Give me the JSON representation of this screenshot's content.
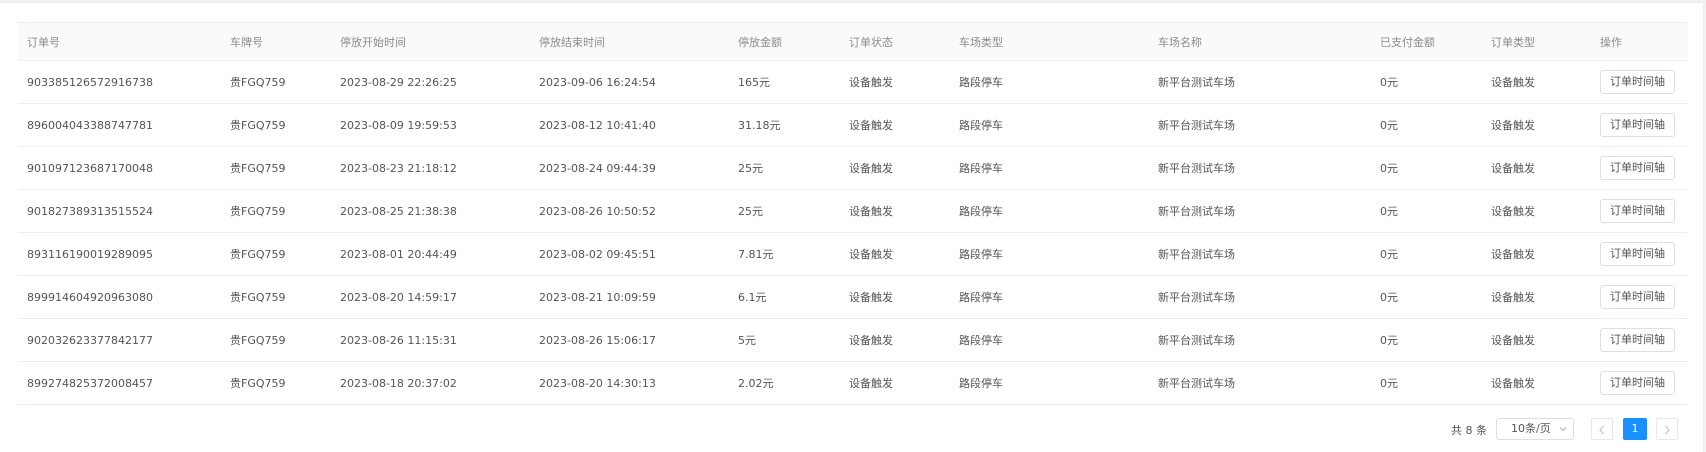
{
  "table": {
    "columns": [
      "订单号",
      "车牌号",
      "停放开始时间",
      "停放结束时间",
      "停放金额",
      "订单状态",
      "车场类型",
      "车场名称",
      "已支付金额",
      "订单类型",
      "操作"
    ],
    "rows": [
      {
        "order_no": "903385126572916738",
        "plate": "贵FGQ759",
        "start": "2023-08-29 22:26:25",
        "end": "2023-09-06 16:24:54",
        "amount": "165元",
        "status": "设备触发",
        "lot_type": "路段停车",
        "lot_name": "新平台测试车场",
        "paid": "0元",
        "order_type": "设备触发"
      },
      {
        "order_no": "896004043388747781",
        "plate": "贵FGQ759",
        "start": "2023-08-09 19:59:53",
        "end": "2023-08-12 10:41:40",
        "amount": "31.18元",
        "status": "设备触发",
        "lot_type": "路段停车",
        "lot_name": "新平台测试车场",
        "paid": "0元",
        "order_type": "设备触发"
      },
      {
        "order_no": "901097123687170048",
        "plate": "贵FGQ759",
        "start": "2023-08-23 21:18:12",
        "end": "2023-08-24 09:44:39",
        "amount": "25元",
        "status": "设备触发",
        "lot_type": "路段停车",
        "lot_name": "新平台测试车场",
        "paid": "0元",
        "order_type": "设备触发"
      },
      {
        "order_no": "901827389313515524",
        "plate": "贵FGQ759",
        "start": "2023-08-25 21:38:38",
        "end": "2023-08-26 10:50:52",
        "amount": "25元",
        "status": "设备触发",
        "lot_type": "路段停车",
        "lot_name": "新平台测试车场",
        "paid": "0元",
        "order_type": "设备触发"
      },
      {
        "order_no": "893116190019289095",
        "plate": "贵FGQ759",
        "start": "2023-08-01 20:44:49",
        "end": "2023-08-02 09:45:51",
        "amount": "7.81元",
        "status": "设备触发",
        "lot_type": "路段停车",
        "lot_name": "新平台测试车场",
        "paid": "0元",
        "order_type": "设备触发"
      },
      {
        "order_no": "899914604920963080",
        "plate": "贵FGQ759",
        "start": "2023-08-20 14:59:17",
        "end": "2023-08-21 10:09:59",
        "amount": "6.1元",
        "status": "设备触发",
        "lot_type": "路段停车",
        "lot_name": "新平台测试车场",
        "paid": "0元",
        "order_type": "设备触发"
      },
      {
        "order_no": "902032623377842177",
        "plate": "贵FGQ759",
        "start": "2023-08-26 11:15:31",
        "end": "2023-08-26 15:06:17",
        "amount": "5元",
        "status": "设备触发",
        "lot_type": "路段停车",
        "lot_name": "新平台测试车场",
        "paid": "0元",
        "order_type": "设备触发"
      },
      {
        "order_no": "899274825372008457",
        "plate": "贵FGQ759",
        "start": "2023-08-18 20:37:02",
        "end": "2023-08-20 14:30:13",
        "amount": "2.02元",
        "status": "设备触发",
        "lot_type": "路段停车",
        "lot_name": "新平台测试车场",
        "paid": "0元",
        "order_type": "设备触发"
      }
    ],
    "action_label": "订单时间轴"
  },
  "pagination": {
    "total_text": "共 8 条",
    "page_size": "10条/页",
    "current_page": "1",
    "icons": {
      "prev": "chevron-left-icon",
      "next": "chevron-right-icon",
      "size_dropdown": "chevron-down-icon"
    }
  },
  "colors": {
    "accent": "#1890ff",
    "header_bg": "#fafafa",
    "border": "#ebeef5"
  }
}
